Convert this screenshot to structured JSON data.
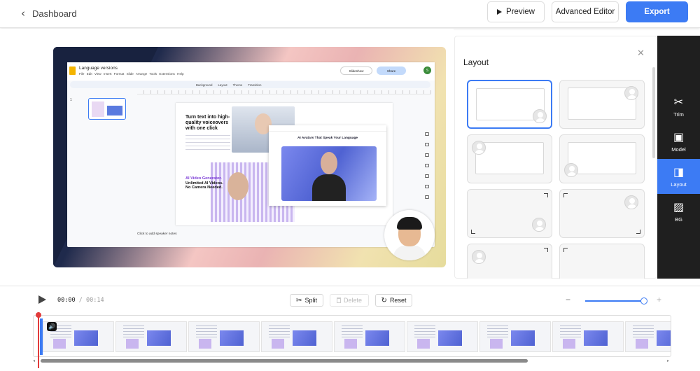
{
  "header": {
    "back_label": "Dashboard",
    "preview_label": "Preview",
    "advanced_label": "Advanced Editor",
    "export_label": "Export"
  },
  "slide": {
    "doc_title": "Language versions",
    "doc_menu": "File  Edit  View  Insert  Format  Slide  Arrange  Tools  Extensions  Help",
    "toolbar": [
      "Background",
      "Layout",
      "Theme",
      "Transition"
    ],
    "slideshow_label": "Slideshow",
    "share_label": "Share",
    "avatar_initial": "S",
    "headline": "Turn text into high-quality voiceovers with one click",
    "headline2_a": "AI Video Generator.",
    "headline2_b": "Unlimited AI Videos. No Camera Needed.",
    "web_title": "AI Avatars That Speak Your Language",
    "speaker_notes": "Click to add speaker notes",
    "slide_number": "1"
  },
  "layout_panel": {
    "title": "Layout",
    "close_icon": "✕"
  },
  "sidebar": {
    "items": [
      {
        "label": "Trim",
        "icon": "✂"
      },
      {
        "label": "Model",
        "icon": "▣"
      },
      {
        "label": "Layout",
        "icon": "◨"
      },
      {
        "label": "BG",
        "icon": "▨"
      }
    ]
  },
  "timeline": {
    "current_time": "00:00",
    "separator": "/",
    "total_time": "00:14",
    "split_label": "Split",
    "delete_label": "Delete",
    "reset_label": "Reset",
    "zoom_minus": "−",
    "zoom_plus": "+",
    "zoom_level_fraction": 1.0
  },
  "colors": {
    "accent": "#3c7bf4",
    "sidebar_bg": "#1f1f1f",
    "playhead": "#e23b3b"
  }
}
